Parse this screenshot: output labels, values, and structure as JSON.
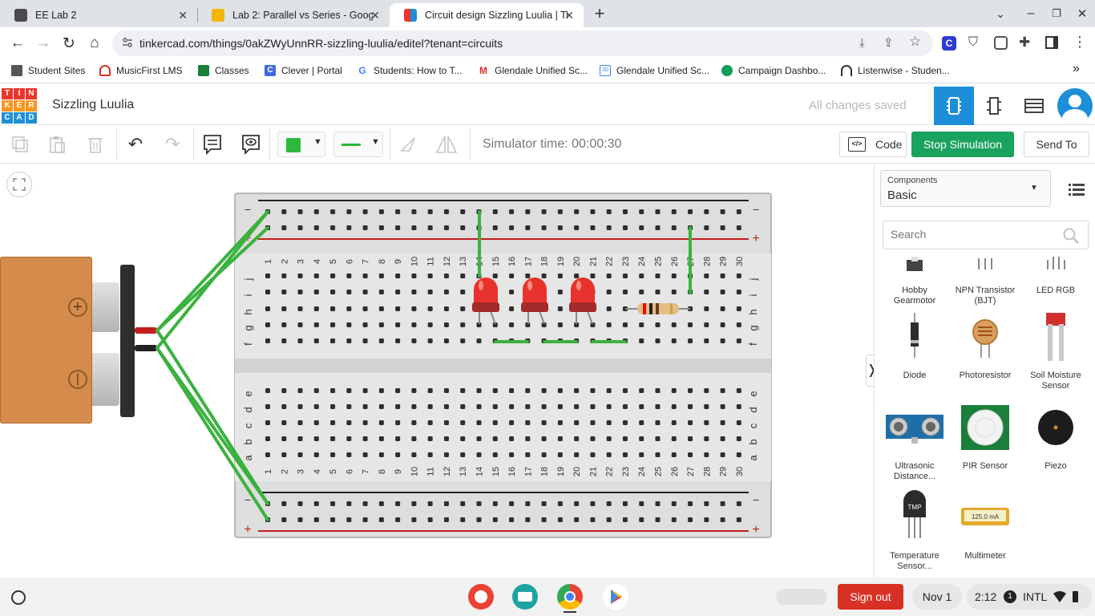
{
  "browser": {
    "tabs": [
      {
        "label": "EE Lab 2",
        "close": "✕",
        "color": "#4a4a4a"
      },
      {
        "label": "Lab 2: Parallel vs Series - Google",
        "close": "✕",
        "color": "#f4b400"
      },
      {
        "label": "Circuit design Sizzling Luulia | Ti",
        "close": "✕",
        "color": "#e8372b"
      }
    ],
    "new_tab": "+",
    "url": "tinkercad.com/things/0akZWyUnnRR-sizzling-luulia/editel?tenant=circuits",
    "bookmarks": [
      {
        "label": "Student Sites",
        "color": "#555555"
      },
      {
        "label": "MusicFirst LMS",
        "color": "#d93025"
      },
      {
        "label": "Classes",
        "color": "#188038"
      },
      {
        "label": "Clever | Portal",
        "color": "#4169e1"
      },
      {
        "label": "Students: How to T...",
        "color": "#4285f4"
      },
      {
        "label": "Glendale Unified Sc...",
        "color": "#d93025"
      },
      {
        "label": "Glendale Unified Sc...",
        "color": "#4285f4"
      },
      {
        "label": "Campaign Dashbo...",
        "color": "#0f9d58"
      },
      {
        "label": "Listenwise - Studen...",
        "color": "#333333"
      }
    ],
    "bookmarks_more": "»"
  },
  "app": {
    "logo": [
      "TIN",
      "KER",
      "CAD"
    ],
    "design_name": "Sizzling Luulia",
    "save_status": "All changes saved",
    "simulator_time": "Simulator time: 00:00:30",
    "code_label": "Code",
    "stop_label": "Stop Simulation",
    "send_label": "Send To",
    "accent": "#1d8fd8",
    "green": "#1aa260"
  },
  "breadboard": {
    "col_numbers": [
      "1",
      "2",
      "3",
      "4",
      "5",
      "6",
      "7",
      "8",
      "9",
      "10",
      "11",
      "12",
      "13",
      "14",
      "15",
      "16",
      "17",
      "18",
      "19",
      "20",
      "21",
      "22",
      "23",
      "24",
      "25",
      "26",
      "27",
      "28",
      "29",
      "30"
    ],
    "top_rows": [
      "j",
      "i",
      "h",
      "g",
      "f"
    ],
    "bottom_rows": [
      "e",
      "d",
      "c",
      "b",
      "a"
    ],
    "minus": "−",
    "plus": "+"
  },
  "battery": {
    "plus_symbol": "+",
    "minus_symbol": "|"
  },
  "panel": {
    "components_label": "Components",
    "components_value": "Basic",
    "search_placeholder": "Search",
    "items": [
      {
        "label": "Hobby Gearmotor"
      },
      {
        "label": "NPN Transistor (BJT)"
      },
      {
        "label": "LED RGB"
      },
      {
        "label": "Diode"
      },
      {
        "label": "Photoresistor"
      },
      {
        "label": "Soil Moisture Sensor"
      },
      {
        "label": "Ultrasonic Distance..."
      },
      {
        "label": "PIR Sensor"
      },
      {
        "label": "Piezo"
      },
      {
        "label": "Temperature Sensor..."
      },
      {
        "label": "Multimeter"
      }
    ],
    "multimeter_readout": "125.0 mA",
    "tmp_label": "TMP"
  },
  "shelf": {
    "sign_out": "Sign out",
    "date": "Nov 1",
    "time": "2:12",
    "notif": "1",
    "ime": "INTL"
  }
}
